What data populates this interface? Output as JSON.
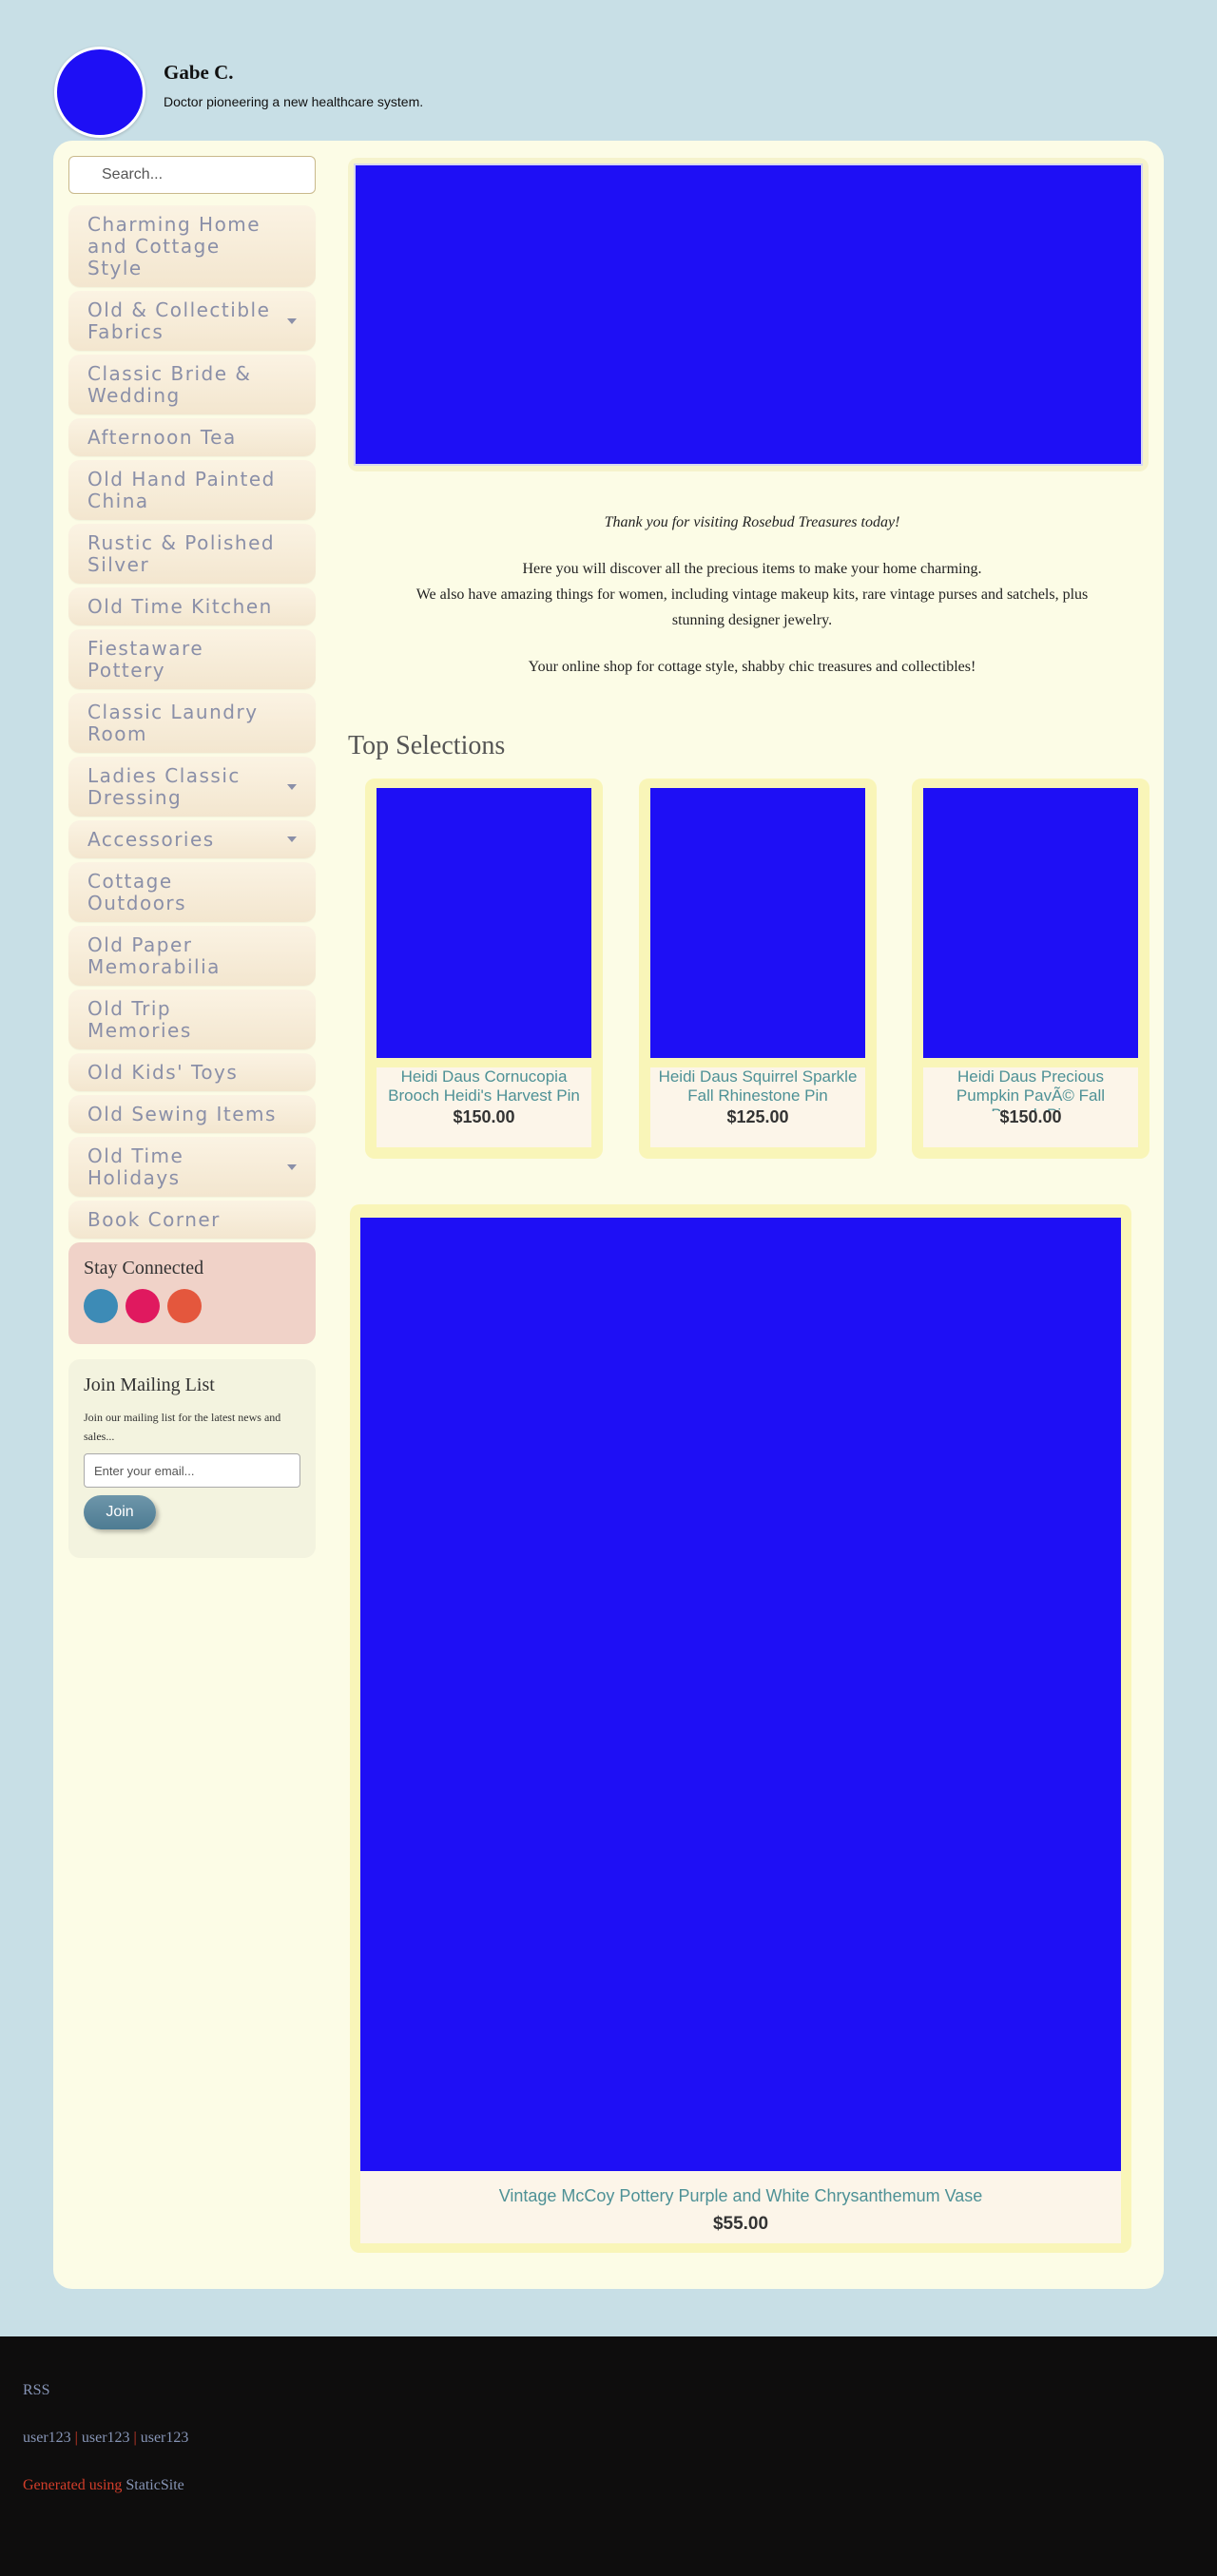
{
  "header": {
    "author_name": "Gabe C.",
    "author_bio": "Doctor pioneering a new healthcare system."
  },
  "sidebar": {
    "search_placeholder": "Search...",
    "nav": [
      {
        "label": "Charming Home and Cottage Style",
        "has_submenu": false
      },
      {
        "label": "Old & Collectible Fabrics",
        "has_submenu": true
      },
      {
        "label": "Classic Bride & Wedding",
        "has_submenu": false
      },
      {
        "label": "Afternoon Tea",
        "has_submenu": false
      },
      {
        "label": "Old Hand Painted China",
        "has_submenu": false
      },
      {
        "label": "Rustic & Polished Silver",
        "has_submenu": false
      },
      {
        "label": "Old Time Kitchen",
        "has_submenu": false
      },
      {
        "label": "Fiestaware Pottery",
        "has_submenu": false
      },
      {
        "label": "Classic Laundry Room",
        "has_submenu": false
      },
      {
        "label": "Ladies Classic Dressing",
        "has_submenu": true
      },
      {
        "label": "Accessories",
        "has_submenu": true
      },
      {
        "label": "Cottage Outdoors",
        "has_submenu": false
      },
      {
        "label": "Old Paper Memorabilia",
        "has_submenu": false
      },
      {
        "label": "Old Trip Memories",
        "has_submenu": false
      },
      {
        "label": "Old Kids' Toys",
        "has_submenu": false
      },
      {
        "label": "Old Sewing Items",
        "has_submenu": false
      },
      {
        "label": "Old Time Holidays",
        "has_submenu": true
      },
      {
        "label": "Book Corner",
        "has_submenu": false
      }
    ],
    "connected": {
      "title": "Stay Connected",
      "icons": [
        {
          "name": "social-icon-blue",
          "color": "#3d8bb6"
        },
        {
          "name": "social-icon-pink",
          "color": "#e0195f"
        },
        {
          "name": "social-icon-orange",
          "color": "#e4573d"
        }
      ]
    },
    "mailing": {
      "title": "Join Mailing List",
      "description": "Join our mailing list for the latest news and sales...",
      "email_placeholder": "Enter your email...",
      "join_label": "Join"
    }
  },
  "main": {
    "intro": {
      "welcome": "Thank you for visiting Rosebud Treasures today!",
      "line1": "Here you will discover all the precious items to make your home charming.",
      "line2": "We also have amazing things for women, including vintage makeup kits, rare vintage purses and satchels, plus stunning designer jewelry.",
      "line3": "Your online shop for cottage style, shabby chic treasures and collectibles!"
    },
    "top_selections_title": "Top Selections",
    "products": [
      {
        "title": "Heidi Daus Cornucopia Brooch Heidi's Harvest Pin",
        "price": "$150.00"
      },
      {
        "title": "Heidi Daus Squirrel Sparkle Fall Rhinestone Pin",
        "price": "$125.00"
      },
      {
        "title": "Heidi Daus Precious Pumpkin PavÃ© Fall Brooch Pin",
        "price": "$150.00"
      }
    ],
    "featured": {
      "title": "Vintage McCoy Pottery Purple and White Chrysanthemum Vase",
      "price": "$55.00"
    }
  },
  "footer": {
    "rss": "RSS",
    "users": [
      "user123",
      "user123",
      "user123"
    ],
    "separator": "|",
    "generated_text": "Generated using",
    "generator": "StaticSite"
  },
  "colors": {
    "page_bg": "#c8dfe6",
    "panel_bg": "#fcfce6",
    "image_placeholder": "#1e0ff5",
    "link_teal": "#4e9196",
    "footer_bg": "#0e0d0d"
  }
}
